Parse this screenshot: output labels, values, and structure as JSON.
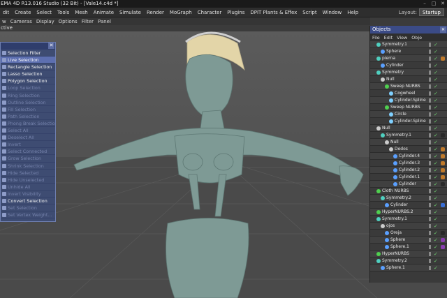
{
  "title": "EMA 4D R13.016 Studio (32 Bit) - [Vale14.c4d *]",
  "menu": [
    "dit",
    "Create",
    "Select",
    "Tools",
    "Mesh",
    "Animate",
    "Simulate",
    "Render",
    "MoGraph",
    "Character",
    "Plugins",
    "DPIT Plants & Effex",
    "Script",
    "Window",
    "Help"
  ],
  "layout": {
    "label": "Layout:",
    "value": "Startup"
  },
  "viewport_menu": [
    "w",
    "Cameras",
    "Display",
    "Options",
    "Filter",
    "Panel"
  ],
  "viewport_label": "ctive",
  "selection_menu": [
    {
      "label": "Selection Filter",
      "state": "on"
    },
    {
      "label": "Live Selection",
      "state": "act"
    },
    {
      "label": "Rectangle Selection",
      "state": "on"
    },
    {
      "label": "Lasso Selection",
      "state": "on"
    },
    {
      "label": "Polygon Selection",
      "state": "on"
    },
    {
      "label": "Loop Selection",
      "state": "off"
    },
    {
      "label": "Ring Selection",
      "state": "off"
    },
    {
      "label": "Outline Selection",
      "state": "off"
    },
    {
      "label": "Fill Selection",
      "state": "off"
    },
    {
      "label": "Path Selection",
      "state": "off"
    },
    {
      "label": "Phong Break Selection",
      "state": "off"
    },
    {
      "label": "Select All",
      "state": "off"
    },
    {
      "label": "Deselect All",
      "state": "off"
    },
    {
      "label": "Invert",
      "state": "off"
    },
    {
      "label": "Select Connected",
      "state": "off"
    },
    {
      "label": "Grow Selection",
      "state": "off"
    },
    {
      "label": "Shrink Selection",
      "state": "off"
    },
    {
      "label": "Hide Selected",
      "state": "off"
    },
    {
      "label": "Hide Unselected",
      "state": "off"
    },
    {
      "label": "Unhide All",
      "state": "off"
    },
    {
      "label": "Invert Visibility",
      "state": "off"
    },
    {
      "label": "Convert Selection",
      "state": "on"
    },
    {
      "label": "Set Selection",
      "state": "off"
    },
    {
      "label": "Set Vertex Weight...",
      "state": "off"
    }
  ],
  "objects": {
    "title": "Objects",
    "menu": [
      "File",
      "Edit",
      "View",
      "Obje"
    ],
    "rows": [
      {
        "name": "Symmetry.1",
        "indent": 1,
        "color": "#4fd0c0",
        "tag": ""
      },
      {
        "name": "Sphere",
        "indent": 2,
        "color": "#5aa0ff",
        "tag": ""
      },
      {
        "name": "pierna",
        "indent": 1,
        "color": "#4fd0c0",
        "tag": "#c07a2b"
      },
      {
        "name": "Cylinder",
        "indent": 2,
        "color": "#5aa0ff",
        "tag": ""
      },
      {
        "name": "Symmetry",
        "indent": 1,
        "color": "#4fd0c0",
        "tag": ""
      },
      {
        "name": "Null",
        "indent": 2,
        "color": "#cccccc",
        "tag": ""
      },
      {
        "name": "Sweep NURBS",
        "indent": 3,
        "color": "#4fd04f",
        "tag": ""
      },
      {
        "name": "Cogwheel",
        "indent": 4,
        "color": "#7fd0ff",
        "tag": ""
      },
      {
        "name": "Cylinder.Spline",
        "indent": 4,
        "color": "#7fd0ff",
        "tag": ""
      },
      {
        "name": "Sweep NURBS",
        "indent": 3,
        "color": "#4fd04f",
        "tag": ""
      },
      {
        "name": "Circle",
        "indent": 4,
        "color": "#7fd0ff",
        "tag": ""
      },
      {
        "name": "Cylinder.Spline",
        "indent": 4,
        "color": "#7fd0ff",
        "tag": ""
      },
      {
        "name": "Null",
        "indent": 1,
        "color": "#cccccc",
        "tag": ""
      },
      {
        "name": "Symmetry.1",
        "indent": 2,
        "color": "#4fd0c0",
        "tag": "#2a2a2a"
      },
      {
        "name": "Null",
        "indent": 3,
        "color": "#cccccc",
        "tag": ""
      },
      {
        "name": "Dedos",
        "indent": 4,
        "color": "#cccccc",
        "tag": "#c07a2b"
      },
      {
        "name": "Cylinder.4",
        "indent": 5,
        "color": "#5aa0ff",
        "tag": "#c07a2b"
      },
      {
        "name": "Cylinder.3",
        "indent": 5,
        "color": "#5aa0ff",
        "tag": "#c07a2b"
      },
      {
        "name": "Cylinder.2",
        "indent": 5,
        "color": "#5aa0ff",
        "tag": "#c07a2b"
      },
      {
        "name": "Cylinder.1",
        "indent": 5,
        "color": "#5aa0ff",
        "tag": "#c07a2b"
      },
      {
        "name": "Cylinder",
        "indent": 5,
        "color": "#5aa0ff",
        "tag": "#2a2a2a"
      },
      {
        "name": "Cloth NURBS",
        "indent": 1,
        "color": "#4fd04f",
        "tag": ""
      },
      {
        "name": "Symmetry.2",
        "indent": 2,
        "color": "#4fd0c0",
        "tag": ""
      },
      {
        "name": "Cylinder",
        "indent": 3,
        "color": "#5aa0ff",
        "tag": "#3a6fd6"
      },
      {
        "name": "HyperNURBS.2",
        "indent": 1,
        "color": "#4fd04f",
        "tag": ""
      },
      {
        "name": "Symmetry.1",
        "indent": 1,
        "color": "#4fd0c0",
        "tag": ""
      },
      {
        "name": "ojos",
        "indent": 2,
        "color": "#cccccc",
        "tag": ""
      },
      {
        "name": "Oreja",
        "indent": 3,
        "color": "#5aa0ff",
        "tag": "#2a2a2a"
      },
      {
        "name": "Sphere",
        "indent": 3,
        "color": "#5aa0ff",
        "tag": "#8a3fb0"
      },
      {
        "name": "Sphere.1",
        "indent": 3,
        "color": "#5aa0ff",
        "tag": "#8a3fb0"
      },
      {
        "name": "HyperNURBS",
        "indent": 1,
        "color": "#4fd04f",
        "tag": ""
      },
      {
        "name": "Symmetry.2",
        "indent": 1,
        "color": "#4fd0c0",
        "tag": ""
      },
      {
        "name": "Sphere.1",
        "indent": 2,
        "color": "#5aa0ff",
        "tag": ""
      }
    ]
  }
}
